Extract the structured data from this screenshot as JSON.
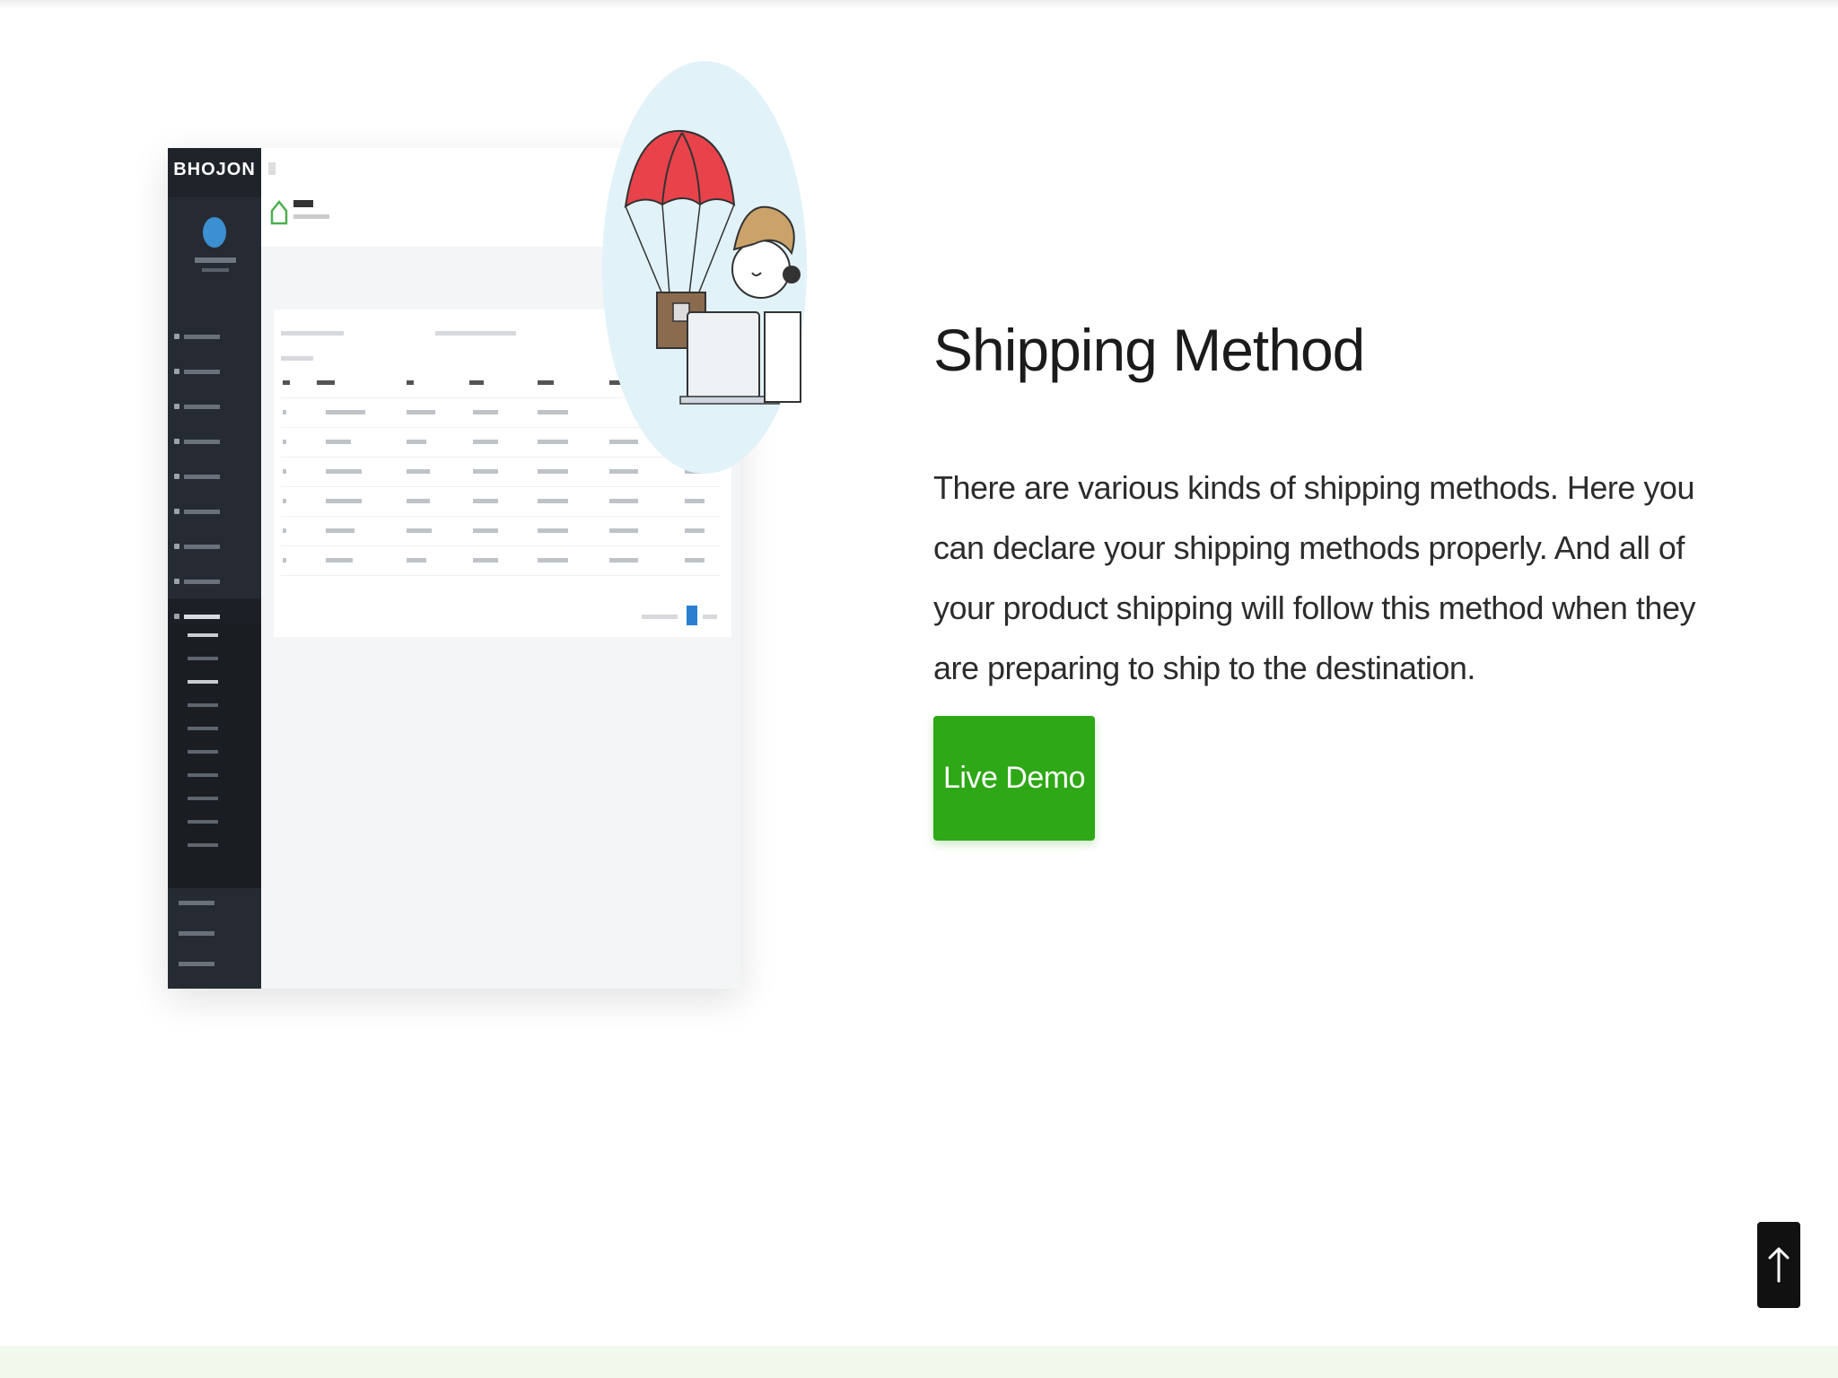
{
  "mockup": {
    "logo_text": "BHOJON"
  },
  "feature": {
    "title": "Shipping Method",
    "description": "There are various kinds of shipping methods. Here you can declare your shipping methods properly. And all of your product shipping will follow this method when they are preparing to ship to the destination.",
    "button_label": "Live Demo"
  },
  "colors": {
    "accent_green": "#2ea816",
    "mock_sidebar": "#262b33",
    "mock_primary": "#2a7fd1"
  },
  "icons": {
    "scroll_top": "arrow-up-icon",
    "illustration": "parachute-delivery-illustration"
  }
}
